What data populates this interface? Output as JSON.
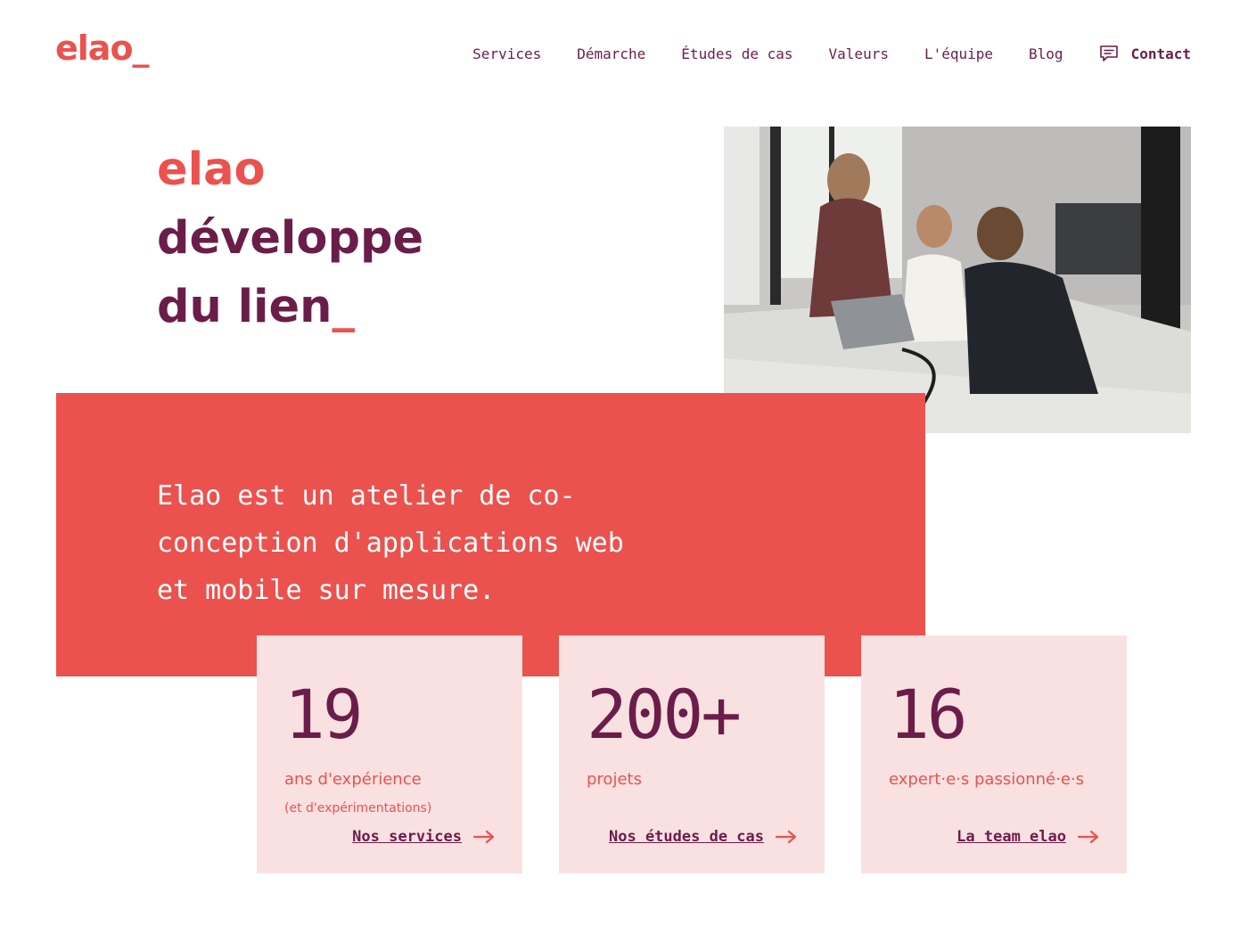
{
  "header": {
    "logo": "elao_",
    "nav": [
      "Services",
      "Démarche",
      "Études de cas",
      "Valeurs",
      "L'équipe",
      "Blog"
    ],
    "contact_label": "Contact"
  },
  "hero": {
    "line1": "elao",
    "line2": "développe",
    "line3": "du lien",
    "cursor": "_"
  },
  "intro": {
    "text": "Elao est un atelier de co-conception d'applications web et mobile sur mesure."
  },
  "stats": [
    {
      "number": "19",
      "label": "ans d'expérience",
      "sub": "(et d'expérimentations)",
      "link": "Nos services"
    },
    {
      "number": "200+",
      "label": "projets",
      "sub": "",
      "link": "Nos études de cas"
    },
    {
      "number": "16",
      "label": "expert·e·s passionné·e·s",
      "sub": "",
      "link": "La team elao"
    }
  ],
  "colors": {
    "brand_red": "#eb524e",
    "plum": "#6b1d4a",
    "blush": "#f9e1e1"
  },
  "icons": {
    "contact": "chat-icon",
    "stat_link": "arrow-right-icon"
  }
}
